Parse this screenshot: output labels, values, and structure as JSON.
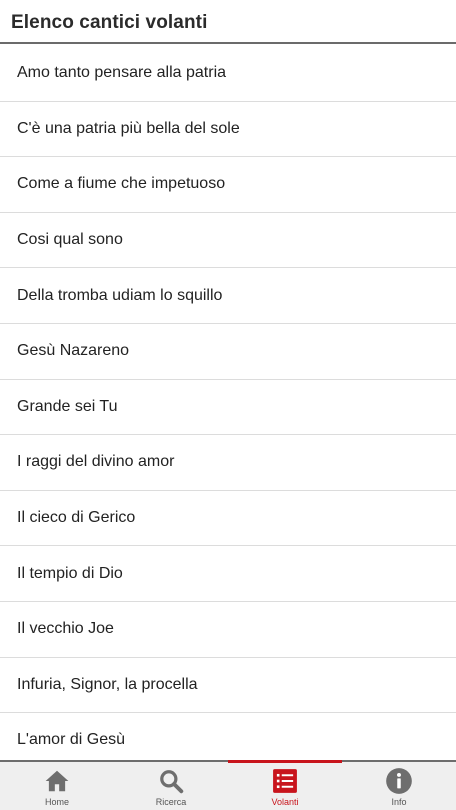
{
  "header": {
    "title": "Elenco cantici volanti"
  },
  "songs": [
    "Amo tanto pensare alla patria",
    "C'è una patria più bella del sole",
    "Come a fiume che impetuoso",
    "Cosi qual sono",
    "Della tromba udiam lo squillo",
    "Gesù Nazareno",
    "Grande sei Tu",
    "I raggi del divino amor",
    "Il cieco di Gerico",
    "Il tempio di Dio",
    "Il vecchio Joe",
    "Infuria, Signor, la procella",
    "L'amor di Gesù"
  ],
  "tabs": [
    {
      "label": "Home",
      "icon": "home-icon"
    },
    {
      "label": "Ricerca",
      "icon": "search-icon"
    },
    {
      "label": "Volanti",
      "icon": "list-icon"
    },
    {
      "label": "Info",
      "icon": "info-icon"
    }
  ],
  "active_tab": "Volanti",
  "colors": {
    "accent": "#c8141c",
    "icon_inactive": "#6e6e6e",
    "tabbar_bg": "#efefef"
  }
}
